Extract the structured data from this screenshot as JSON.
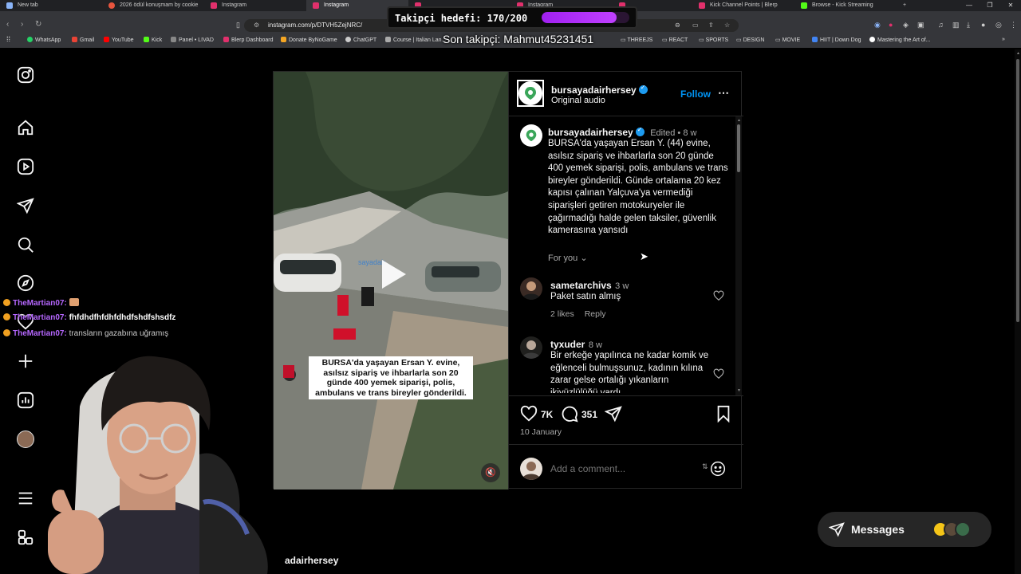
{
  "browser": {
    "tabs": [
      {
        "label": "New tab",
        "color": "#8ab4f8"
      },
      {
        "label": "2026 ödül konuşmam by cookie",
        "color": "#e8553e"
      },
      {
        "label": "Instagram",
        "color": "#e1306c"
      },
      {
        "label": "Instagram",
        "color": "#e1306c"
      },
      {
        "label": "",
        "color": "#e1306c"
      },
      {
        "label": "Instagram",
        "color": "#e1306c"
      },
      {
        "label": "",
        "color": "#e1306c"
      },
      {
        "label": "Kick Channel Points | Blerp",
        "color": "#e1306c"
      },
      {
        "label": "Browse - Kick Streaming",
        "color": "#53fc18"
      }
    ],
    "url": "instagram.com/p/DTVH5ZejNRC/",
    "bookmarks": [
      {
        "label": "WhatsApp",
        "color": "#25d366"
      },
      {
        "label": "Gmail",
        "color": "#ea4335"
      },
      {
        "label": "YouTube",
        "color": "#ff0000"
      },
      {
        "label": "Kick",
        "color": "#53fc18"
      },
      {
        "label": "Panel • LIVAD",
        "color": "#888888"
      },
      {
        "label": "Blerp Dashboard",
        "color": "#e1306c"
      },
      {
        "label": "Donate ByNoGame",
        "color": "#f5a623"
      },
      {
        "label": "ChatGPT",
        "color": "#cccccc"
      },
      {
        "label": "Course | Italian Lan...",
        "color": "#aaaaaa"
      },
      {
        "label": "THREEJS",
        "color": "#aaaaaa"
      },
      {
        "label": "REACT",
        "color": "#aaaaaa"
      },
      {
        "label": "SPORTS",
        "color": "#aaaaaa"
      },
      {
        "label": "DESIGN",
        "color": "#aaaaaa"
      },
      {
        "label": "MOVIE",
        "color": "#aaaaaa"
      },
      {
        "label": "HIIT | Down Dog",
        "color": "#4285f4"
      },
      {
        "label": "Mastering the Art of...",
        "color": "#111111"
      }
    ]
  },
  "overlay": {
    "goal_text": "Takipçi hedefi: 170/200",
    "goal_progress": 0.85,
    "last_follower": "Son takipçi: Mahmut45231451"
  },
  "chat": [
    {
      "user": "TheMartian07:",
      "message": ""
    },
    {
      "user": "TheMartian07:",
      "message": "fhfdhdfhfdhfdhdfshdfshsdfz"
    },
    {
      "user": "TheMartian07:",
      "message": "transların gazabına uğramış"
    }
  ],
  "post": {
    "author": "bursayadairhersey",
    "audio": "Original audio",
    "follow_label": "Follow",
    "caption_meta": "Edited • 8 w",
    "caption": "BURSA'da yaşayan Ersan Y. (44) evine, asılsız sipariş ve ihbarlarla son 20 günde 400 yemek siparişi, polis, ambulans ve trans bireyler gönderildi. Günde ortalama 20 kez kapısı çalınan Yalçuva'ya vermediği siparişleri getiren motokuryeler ile çağırmadığı halde gelen taksiler, güvenlik kamerasına yansıdı",
    "for_you": "For you",
    "video_caption": "BURSA'da yaşayan Ersan Y. evine, asılsız sipariş ve ihbarlarla son 20 günde 400 yemek siparişi, polis, ambulans ve trans bireyler gönderildi.",
    "watermark": "sayadair",
    "comments": [
      {
        "user": "sametarchivs",
        "time": "3 w",
        "text": "Paket satın almış",
        "likes": "2 likes",
        "reply": "Reply"
      },
      {
        "user": "tyxuder",
        "time": "8 w",
        "text": "Bir erkeğe yapılınca ne kadar komik ve eğlenceli bulmuşsunuz, kadının kılına zarar gelse ortalığı yıkanların ikiyüzlülüğü yardı",
        "likes": "",
        "reply": ""
      }
    ],
    "likes": "7K",
    "comment_count": "351",
    "date": "10 January",
    "comment_placeholder": "Add a comment..."
  },
  "messages_label": "Messages",
  "webcam_name": "adairhersey",
  "colors": {
    "accent": "#0095f6",
    "goal": "#a020f0",
    "chat_user": "#b667ff"
  }
}
